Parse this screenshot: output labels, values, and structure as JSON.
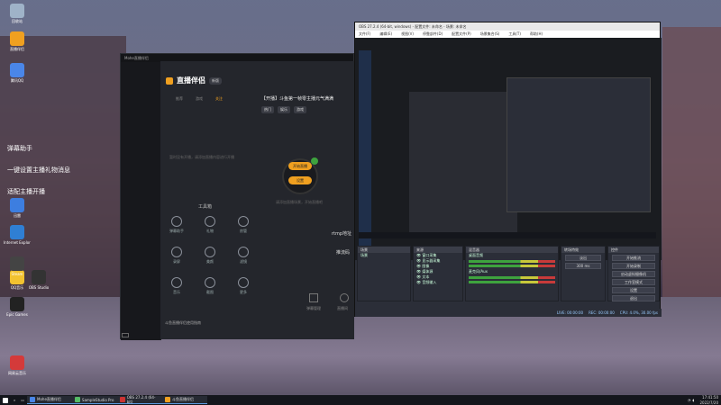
{
  "desktop": {
    "icons": [
      {
        "label": "回收站",
        "color": "#9fb3c8"
      },
      {
        "label": "直播伴侣",
        "color": "#f0a020"
      },
      {
        "label": "腾讯QQ",
        "color": "#4a86e8"
      },
      {
        "label": "迅雷",
        "color": "#3d7ee0"
      },
      {
        "label": "QQ音乐",
        "color": "#f2c230"
      },
      {
        "label": "Internet Explorer",
        "color": "#2f7fd4"
      },
      {
        "label": "Steam",
        "color": "#444"
      },
      {
        "label": "OBS Studio",
        "color": "#333"
      },
      {
        "label": "Epic Games",
        "color": "#222"
      },
      {
        "label": "网易云音乐",
        "color": "#d43a3a"
      }
    ],
    "overlay_lines": [
      "弹幕助手",
      "一键设置主播礼物消息",
      "适配主播开播"
    ]
  },
  "helper": {
    "window_title": "Mohe直播伴侣",
    "logo": "直播伴侣",
    "version": "新版",
    "tabs": [
      "推荐",
      "游戏",
      "关注"
    ],
    "stream_title": "【开播】斗鱼第一帧零主播元气满满",
    "tags": [
      "热门",
      "娱乐",
      "游戏"
    ],
    "empty_hint": "暂时没有开播，请添加直播内容进行开播",
    "toolbox_title": "工具箱",
    "tools": [
      "弹幕助手",
      "礼物",
      "房管",
      "录屏",
      "美颜",
      "滤镜",
      "音乐",
      "截图",
      "更多"
    ],
    "start_label": "开始直播",
    "start2_label": "设置",
    "scene_hint": "请添加直播场景，开始直播吧",
    "rtmp_label": "rtmp地址",
    "stream_key_label": "推流码",
    "footer_hint": "斗鱼直播伴侣使用指南",
    "bottom_buttons": [
      "弹幕管理",
      "直播间"
    ]
  },
  "obs": {
    "title": "OBS 27.2.4 (64-bit, windows) - 配置文件: 未命名 - 场景: 未命名",
    "menu": [
      "文件(F)",
      "编辑(E)",
      "视图(V)",
      "停靠部件(D)",
      "配置文件(P)",
      "场景集合(S)",
      "工具(T)",
      "帮助(H)"
    ],
    "panels": {
      "scenes": "场景",
      "sources": "来源",
      "mixer": "混音器",
      "transitions": "转场特效",
      "controls": "控件"
    },
    "scene_items": [
      "场景"
    ],
    "source_items": [
      "窗口采集",
      "显示器采集",
      "图像",
      "媒体源",
      "文本",
      "音频输入"
    ],
    "mixer_tracks": [
      "桌面音频",
      "麦克风/Aux"
    ],
    "transition_label": "淡出",
    "duration_label": "300 ms",
    "control_buttons": [
      "开始推流",
      "开始录制",
      "启动虚拟摄像机",
      "工作室模式",
      "设置",
      "退出"
    ],
    "status": [
      "LIVE: 00:00:00",
      "REC: 00:00:00",
      "CPU: 4.0%, 30.00 fps"
    ]
  },
  "taskbar": {
    "apps": [
      "Mohe直播伴侣",
      "SampleStudio Pro",
      "OBS 27.2.4 (64-bit)",
      "斗鱼直播伴侣"
    ],
    "time": "17:41:50",
    "date": "2022/7/20"
  }
}
